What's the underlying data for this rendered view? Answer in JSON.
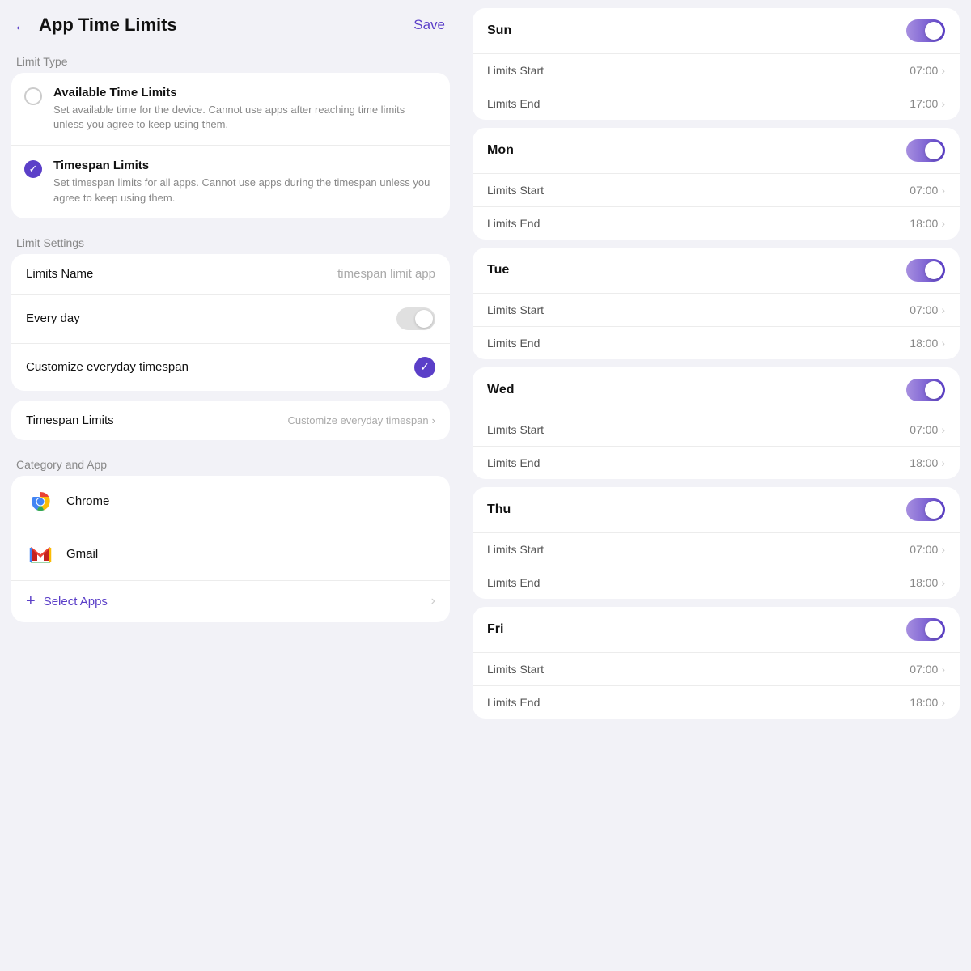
{
  "header": {
    "title": "App Time Limits",
    "save_label": "Save",
    "back_label": "←"
  },
  "limit_type": {
    "section_label": "Limit Type",
    "options": [
      {
        "id": "available",
        "title": "Available Time Limits",
        "description": "Set available time for the device. Cannot use apps after reaching time limits unless you agree to keep using them.",
        "selected": false
      },
      {
        "id": "timespan",
        "title": "Timespan Limits",
        "description": "Set timespan limits for all apps. Cannot use apps during the timespan unless you agree to keep using them.",
        "selected": true
      }
    ]
  },
  "limit_settings": {
    "section_label": "Limit Settings",
    "name_label": "Limits Name",
    "name_value": "timespan limit app",
    "every_day_label": "Every day",
    "customize_label": "Customize everyday timespan",
    "timespan_label": "Timespan Limits",
    "timespan_value": "Customize everyday timespan",
    "chevron": "›"
  },
  "category_app": {
    "section_label": "Category and App",
    "apps": [
      {
        "name": "Chrome",
        "icon": "chrome"
      },
      {
        "name": "Gmail",
        "icon": "gmail"
      }
    ],
    "select_label": "Select Apps",
    "chevron": "›"
  },
  "days": [
    {
      "name": "Sun",
      "enabled": true,
      "limits_start_label": "Limits Start",
      "limits_start_value": "07:00",
      "limits_end_label": "Limits End",
      "limits_end_value": "17:00"
    },
    {
      "name": "Mon",
      "enabled": true,
      "limits_start_label": "Limits Start",
      "limits_start_value": "07:00",
      "limits_end_label": "Limits End",
      "limits_end_value": "18:00"
    },
    {
      "name": "Tue",
      "enabled": true,
      "limits_start_label": "Limits Start",
      "limits_start_value": "07:00",
      "limits_end_label": "Limits End",
      "limits_end_value": "18:00"
    },
    {
      "name": "Wed",
      "enabled": true,
      "limits_start_label": "Limits Start",
      "limits_start_value": "07:00",
      "limits_end_label": "Limits End",
      "limits_end_value": "18:00"
    },
    {
      "name": "Thu",
      "enabled": true,
      "limits_start_label": "Limits Start",
      "limits_start_value": "07:00",
      "limits_end_label": "Limits End",
      "limits_end_value": "18:00"
    },
    {
      "name": "Fri",
      "enabled": true,
      "limits_start_label": "Limits Start",
      "limits_start_value": "07:00",
      "limits_end_label": "Limits End",
      "limits_end_value": "18:00"
    }
  ],
  "icons": {
    "chevron": "›",
    "check": "✓",
    "back": "←",
    "plus": "+"
  },
  "colors": {
    "accent": "#5b3fc8",
    "toggle_gradient_start": "#a78fe0",
    "toggle_gradient_end": "#5b3fc8"
  }
}
